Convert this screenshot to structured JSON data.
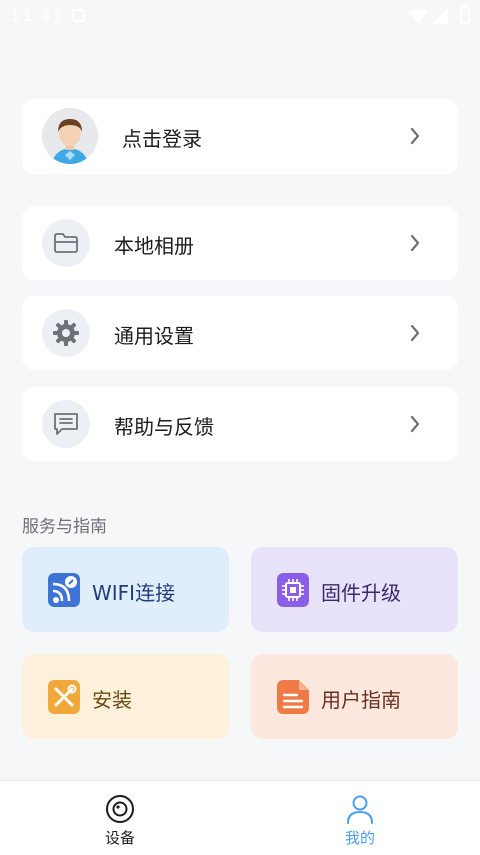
{
  "status_bar": {
    "time": "11:41"
  },
  "login": {
    "label": "点击登录"
  },
  "menu": [
    {
      "id": "album",
      "label": "本地相册",
      "icon": "folder-icon"
    },
    {
      "id": "settings",
      "label": "通用设置",
      "icon": "gear-icon"
    },
    {
      "id": "help",
      "label": "帮助与反馈",
      "icon": "message-icon"
    }
  ],
  "services": {
    "title": "服务与指南",
    "tiles": [
      {
        "label": "WIFI连接",
        "icon": "wifi-link-icon",
        "text_color": "#1f3f7a"
      },
      {
        "label": "固件升级",
        "icon": "chip-icon",
        "text_color": "#3b2a6b"
      },
      {
        "label": "安装",
        "icon": "tools-icon",
        "text_color": "#6b4a14"
      },
      {
        "label": "用户指南",
        "icon": "document-icon",
        "text_color": "#6b2f1d"
      }
    ]
  },
  "tabbar": {
    "tabs": [
      {
        "label": "设备",
        "icon": "device-icon",
        "active": false
      },
      {
        "label": "我的",
        "icon": "user-icon",
        "active": true
      }
    ]
  },
  "colors": {
    "accent": "#4a9ef0",
    "background": "#f6f7f9"
  }
}
